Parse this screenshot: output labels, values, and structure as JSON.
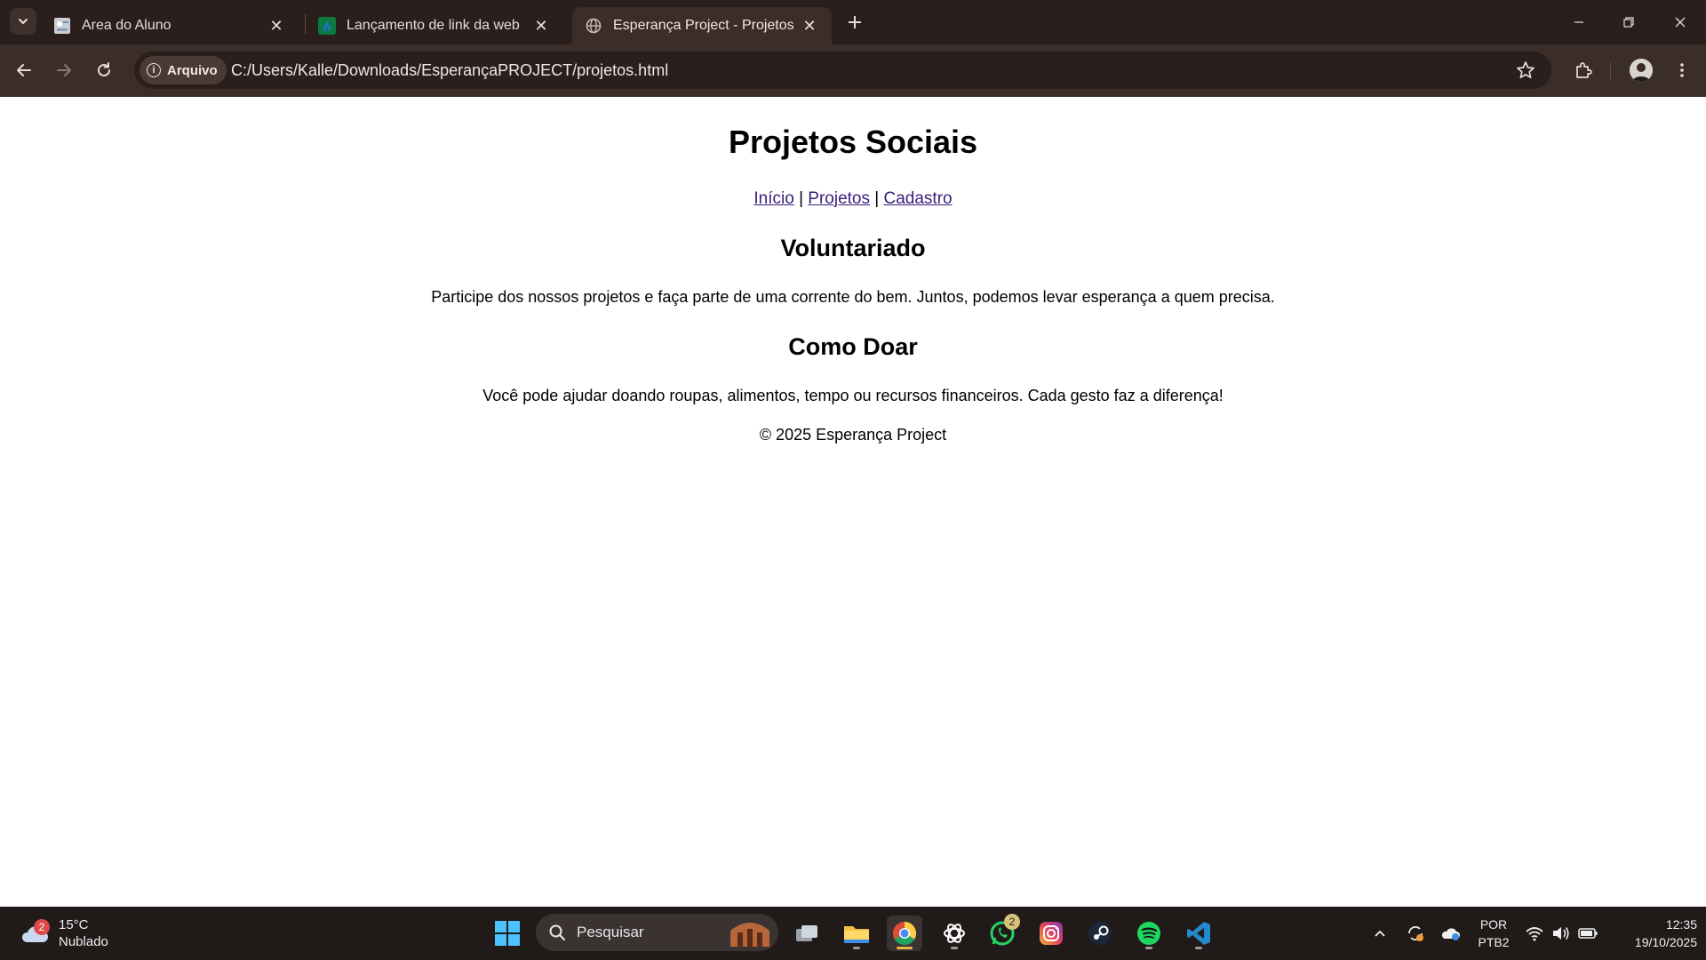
{
  "browser": {
    "tabs": [
      {
        "title": "Area do Aluno",
        "favicon": "aluno-favicon-icon",
        "active": false
      },
      {
        "title": "Lançamento de link da web",
        "favicon": "anhanguera-favicon-icon",
        "active": false
      },
      {
        "title": "Esperança Project - Projetos",
        "favicon": "globe-icon",
        "active": true
      }
    ],
    "site_chip_label": "Arquivo",
    "url": "C:/Users/Kalle/Downloads/EsperançaPROJECT/projetos.html"
  },
  "page": {
    "title": "Projetos Sociais",
    "nav": {
      "inicio": "Início",
      "separator": "|",
      "projetos": "Projetos",
      "cadastro": "Cadastro"
    },
    "section1": {
      "heading": "Voluntariado",
      "text": "Participe dos nossos projetos e faça parte de uma corrente do bem. Juntos, podemos levar esperança a quem precisa."
    },
    "section2": {
      "heading": "Como Doar",
      "text": "Você pode ajudar doando roupas, alimentos, tempo ou recursos financeiros. Cada gesto faz a diferença!"
    },
    "footer": "© 2025 Esperança Project"
  },
  "taskbar": {
    "weather_badge": "2",
    "temperature": "15°C",
    "condition": "Nublado",
    "search_placeholder": "Pesquisar",
    "whatsapp_badge": "2",
    "lang_line1": "POR",
    "lang_line2": "PTB2",
    "time": "12:35",
    "date": "19/10/2025"
  }
}
